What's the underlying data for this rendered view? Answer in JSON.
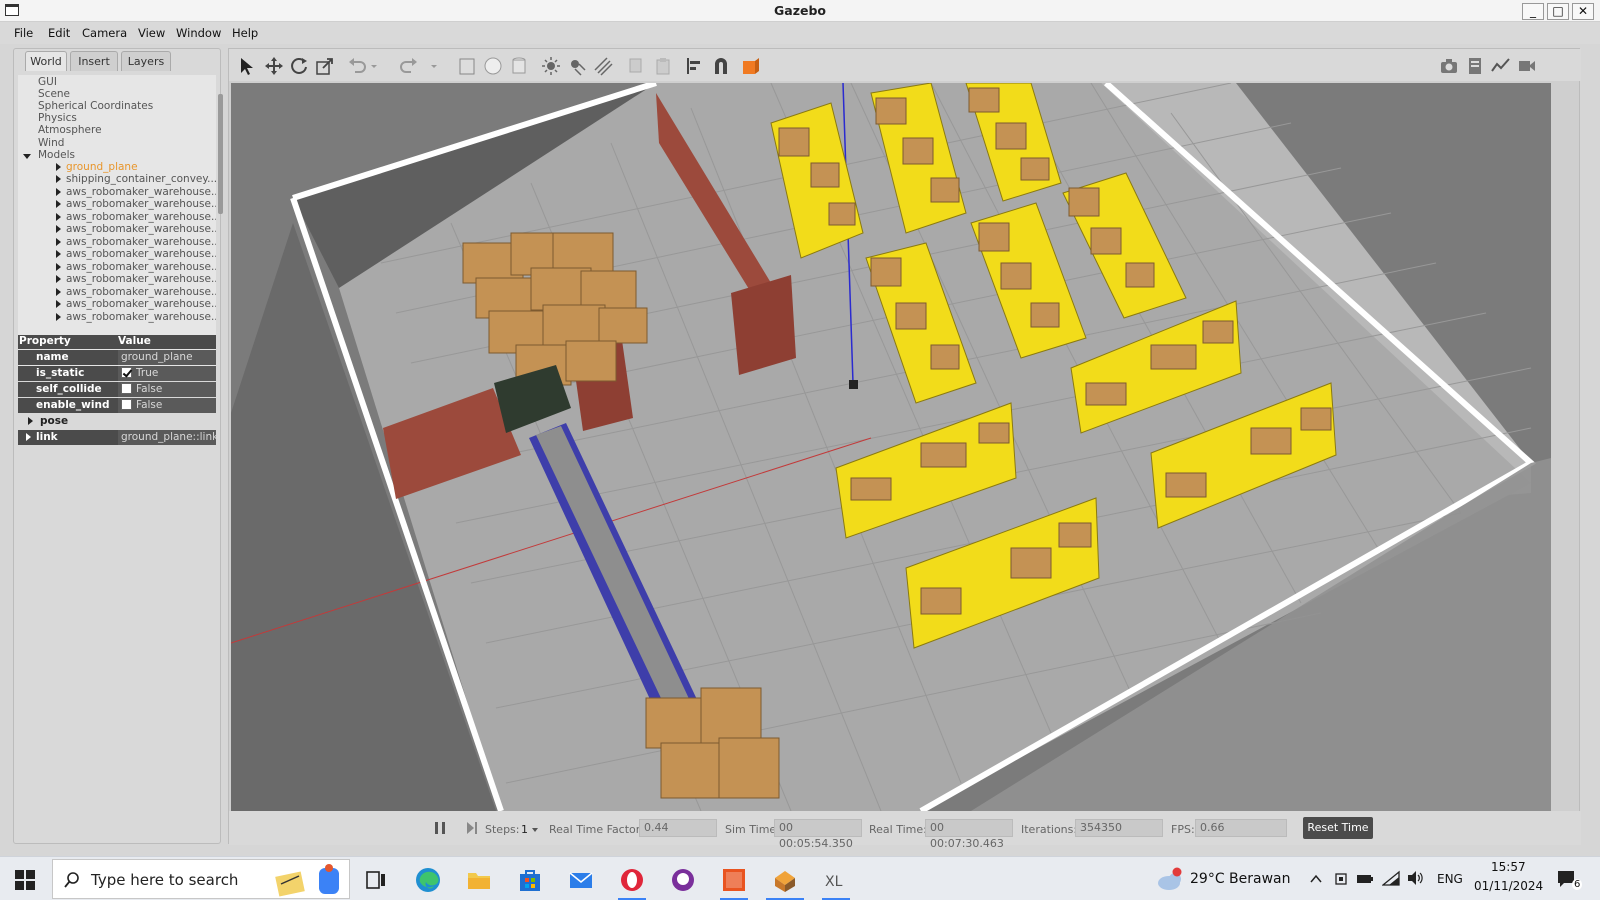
{
  "window": {
    "title": "Gazebo",
    "controls": [
      "_",
      "□",
      "✕"
    ]
  },
  "menu": [
    "File",
    "Edit",
    "Camera",
    "View",
    "Window",
    "Help"
  ],
  "left_panel": {
    "tabs": [
      "World",
      "Insert",
      "Layers"
    ],
    "tree": {
      "items": [
        "GUI",
        "Scene",
        "Spherical Coordinates",
        "Physics",
        "Atmosphere",
        "Wind"
      ],
      "models_label": "Models",
      "models": [
        "ground_plane",
        "shipping_container_convey...",
        "aws_robomaker_warehouse...",
        "aws_robomaker_warehouse...",
        "aws_robomaker_warehouse...",
        "aws_robomaker_warehouse...",
        "aws_robomaker_warehouse...",
        "aws_robomaker_warehouse...",
        "aws_robomaker_warehouse...",
        "aws_robomaker_warehouse...",
        "aws_robomaker_warehouse...",
        "aws_robomaker_warehouse...",
        "aws_robomaker_warehouse..."
      ]
    },
    "properties": {
      "header_property": "Property",
      "header_value": "Value",
      "rows": [
        {
          "key": "name",
          "value": "ground_plane"
        },
        {
          "key": "is_static",
          "value": "True",
          "checked": true
        },
        {
          "key": "self_collide",
          "value": "False",
          "checked": false
        },
        {
          "key": "enable_wind",
          "value": "False",
          "checked": false
        }
      ],
      "groups": [
        {
          "key": "pose",
          "value": ""
        },
        {
          "key": "link",
          "value": "ground_plane::link"
        }
      ]
    }
  },
  "bottom_bar": {
    "steps_label": "Steps:",
    "steps_value": "1",
    "rtf_label": "Real Time Factor:",
    "rtf_value": "0.44",
    "sim_time_label": "Sim Time:",
    "sim_time_value": "00 00:05:54.350",
    "real_time_label": "Real Time:",
    "real_time_value": "00 00:07:30.463",
    "iterations_label": "Iterations:",
    "iterations_value": "354350",
    "fps_label": "FPS:",
    "fps_value": "0.66",
    "reset_label": "Reset Time"
  },
  "taskbar": {
    "search_placeholder": "Type here to search",
    "weather": "29°C  Berawan",
    "lang": "ENG",
    "time": "15:57",
    "date": "01/11/2024",
    "notification_count": "6"
  },
  "colors": {
    "selected_tree_item": "#e8962c",
    "property_bg": "#4b4b4b",
    "shelf_yellow": "#f2dc1a",
    "box_brown": "#c49254",
    "brick": "#9c4a3c",
    "conveyor_blue": "#3e3eaa"
  }
}
